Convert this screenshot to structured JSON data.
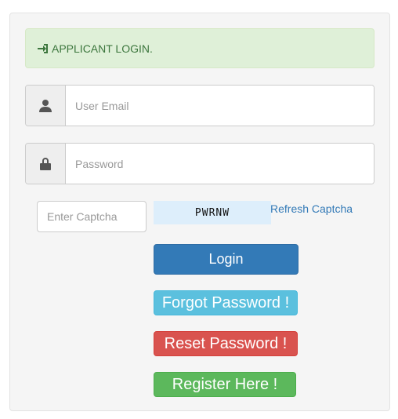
{
  "alert": {
    "icon": "sign-in-icon",
    "text": "APPLICANT LOGIN."
  },
  "email": {
    "icon": "user-icon",
    "placeholder": "User Email",
    "value": ""
  },
  "password": {
    "icon": "lock-icon",
    "placeholder": "Password",
    "value": ""
  },
  "captcha": {
    "placeholder": "Enter Captcha",
    "value": "",
    "code": "PWRNW",
    "refresh_label": "Refresh Captcha"
  },
  "buttons": {
    "login": "Login",
    "forgot": "Forgot Password !",
    "reset": "Reset Password !",
    "register": "Register Here !"
  },
  "colors": {
    "primary": "#337ab7",
    "info": "#5bc0de",
    "danger": "#d9534f",
    "success": "#5cb85c",
    "alert_bg": "#dff0d8",
    "alert_text": "#3c763d"
  }
}
